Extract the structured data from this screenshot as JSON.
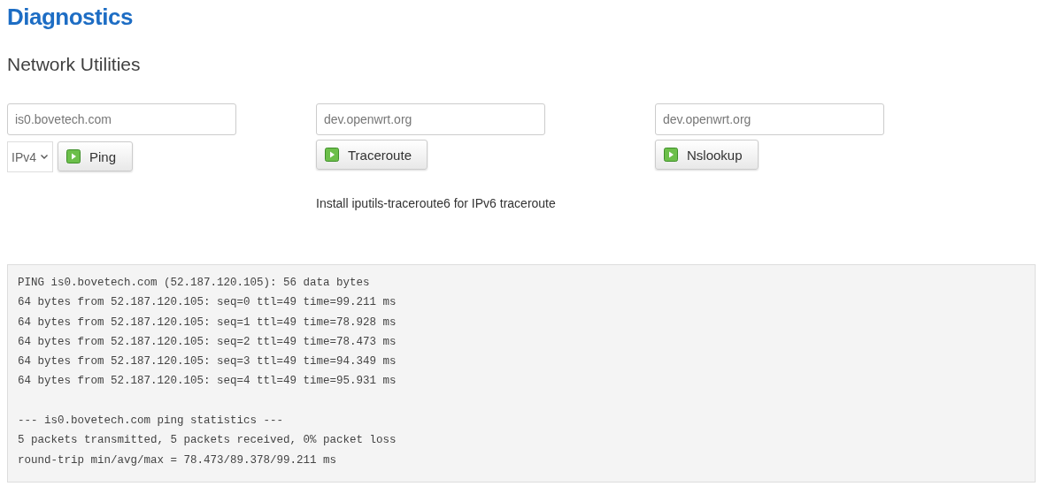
{
  "page_title": "Diagnostics",
  "section_title": "Network Utilities",
  "tools": [
    {
      "kind": "ping",
      "value": "is0.bovetech.com",
      "protocol": "IPv4",
      "button": "Ping"
    },
    {
      "kind": "traceroute",
      "value": "dev.openwrt.org",
      "button": "Traceroute",
      "note": "Install iputils-traceroute6 for IPv6 traceroute"
    },
    {
      "kind": "nslookup",
      "value": "dev.openwrt.org",
      "button": "Nslookup"
    }
  ],
  "output": "PING is0.bovetech.com (52.187.120.105): 56 data bytes\n64 bytes from 52.187.120.105: seq=0 ttl=49 time=99.211 ms\n64 bytes from 52.187.120.105: seq=1 ttl=49 time=78.928 ms\n64 bytes from 52.187.120.105: seq=2 ttl=49 time=78.473 ms\n64 bytes from 52.187.120.105: seq=3 ttl=49 time=94.349 ms\n64 bytes from 52.187.120.105: seq=4 ttl=49 time=95.931 ms\n\n--- is0.bovetech.com ping statistics ---\n5 packets transmitted, 5 packets received, 0% packet loss\nround-trip min/avg/max = 78.473/89.378/99.211 ms"
}
